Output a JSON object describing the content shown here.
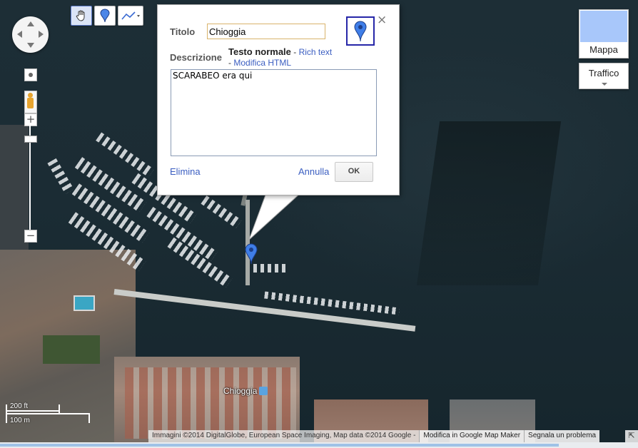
{
  "map": {
    "place_label": "Chioggia",
    "scale": {
      "feet": "200 ft",
      "meters": "100 m"
    },
    "attribution": "Immagini ©2014 DigitalGlobe, European Space Imaging, Map data ©2014 Google -",
    "edit_link": "Modifica in Google Map Maker",
    "report_link": "Segnala un problema"
  },
  "map_type": {
    "map_label": "Mappa",
    "traffic_label": "Traffico"
  },
  "toolbar": {
    "tools": [
      "hand-tool",
      "placemark-tool",
      "line-tool"
    ]
  },
  "info_window": {
    "title_label": "Titolo",
    "title_value": "Chioggia",
    "description_label": "Descrizione",
    "mode_plain": "Testo normale",
    "separator": "-",
    "mode_rich": "Rich text",
    "mode_html": "Modifica HTML",
    "description_value": "SCARABEO era qui",
    "delete_label": "Elimina",
    "cancel_label": "Annulla",
    "ok_label": "OK",
    "close_glyph": "×"
  },
  "colors": {
    "accent": "#3b5ec1",
    "marker": "#3f7ee8",
    "title_border": "#d9b36b"
  }
}
